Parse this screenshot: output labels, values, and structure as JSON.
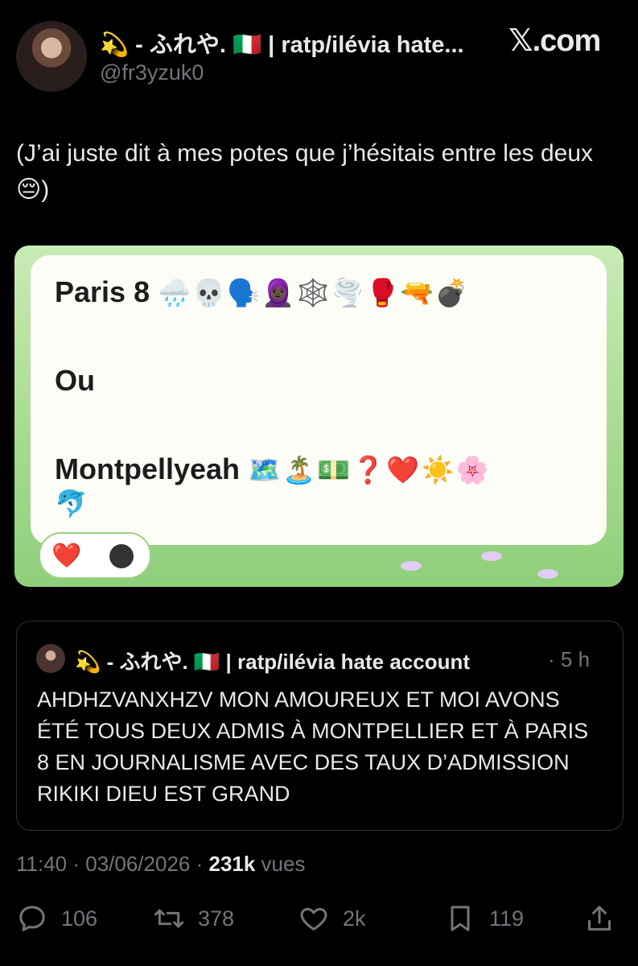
{
  "header": {
    "display_name": "💫 - ふれや. 🇮🇹 | ratp/ilévia hate...",
    "handle": "@fr3yzuk0",
    "site_logo": "𝕏.com"
  },
  "tweet": {
    "text": "(J’ai juste dit à mes potes que j’hésitais entre les deux 😔)"
  },
  "media": {
    "line1_label": "Paris 8",
    "line1_emojis": "🌧️💀🗣️🧕🏿🕸️🌪️🥊🔫💣",
    "line2_label": "Ou",
    "line3_label": "Montpellyeah",
    "line3_emojis": "🗺️🏝️💵❓❤️☀️🌸",
    "line3b_emojis": "🐬",
    "reaction_emoji": "❤️"
  },
  "quote": {
    "name": "💫 - ふれや. 🇮🇹 | ratp/ilévia hate account",
    "time": "· 5 h",
    "text": "AHDHZVANXHZV MON AMOUREUX ET MOI AVONS ÉTÉ TOUS DEUX ADMIS À MONTPELLIER ET À PARIS 8 EN JOURNALISME AVEC DES TAUX D’ADMISSION RIKIKI DIEU EST GRAND"
  },
  "meta": {
    "time_date": "11:40 · 03/06/2026 · ",
    "views_count": "231k",
    "views_label": " vues"
  },
  "actions": {
    "reply_count": "106",
    "retweet_count": "378",
    "like_count": "2k",
    "bookmark_count": "119"
  },
  "icons": {
    "reply": "reply-icon",
    "retweet": "retweet-icon",
    "like": "heart-icon",
    "bookmark": "bookmark-icon",
    "share": "share-icon"
  },
  "colors": {
    "background": "#000000",
    "text": "#e7e9ea",
    "muted": "#71767b",
    "card_green": "#a8db92"
  }
}
